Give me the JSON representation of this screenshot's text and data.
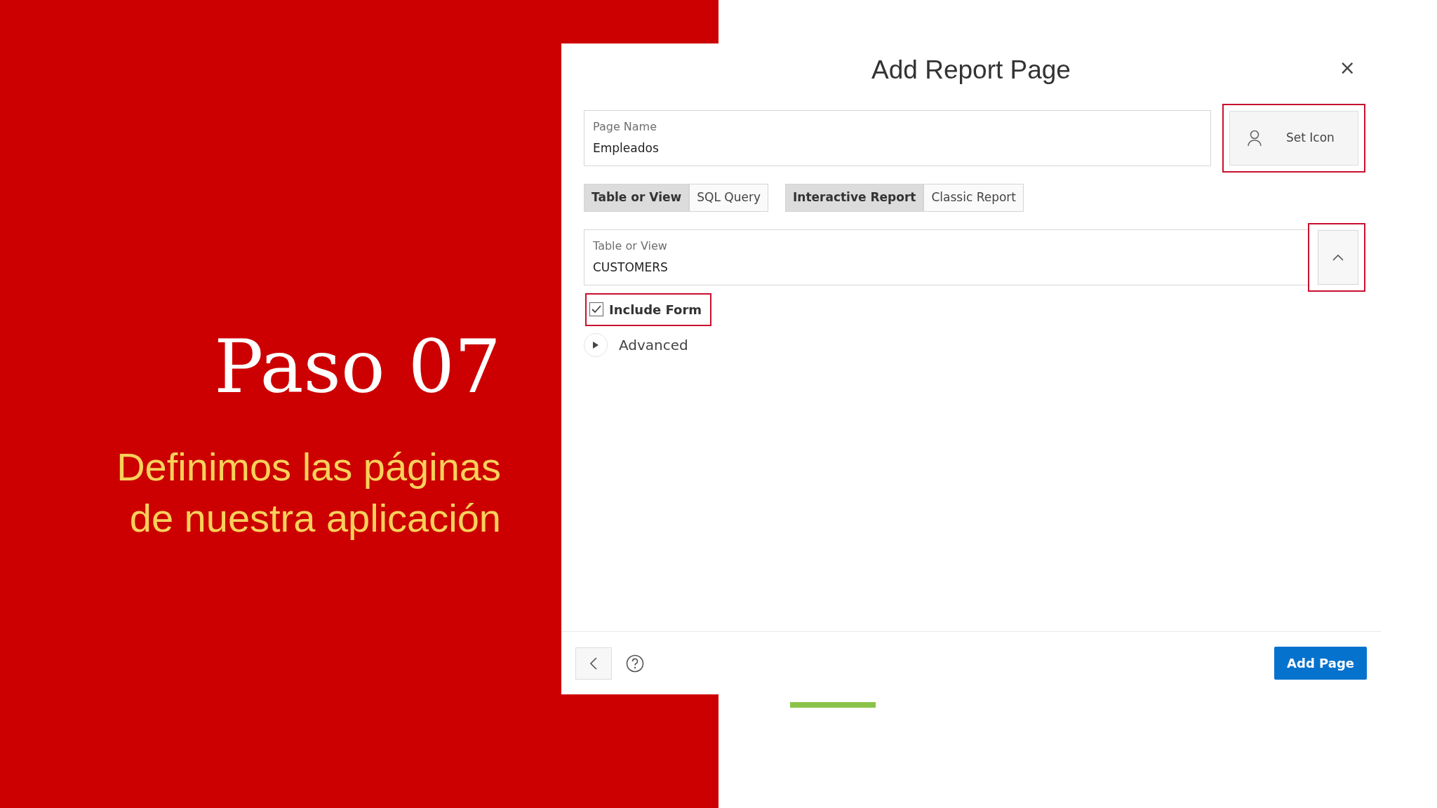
{
  "slide": {
    "title": "Paso 07",
    "subtitle": "Definimos las páginas de nuestra aplicación"
  },
  "dialog": {
    "title": "Add Report Page",
    "close": "×",
    "page_name": {
      "label": "Page Name",
      "value": "Empleados"
    },
    "set_icon": {
      "label": "Set Icon",
      "highlighted": true
    },
    "source_type": [
      {
        "label": "Table or View",
        "selected": true
      },
      {
        "label": "SQL Query",
        "selected": false
      }
    ],
    "report_type": [
      {
        "label": "Interactive Report",
        "selected": true
      },
      {
        "label": "Classic Report",
        "selected": false
      }
    ],
    "table_or_view": {
      "label": "Table or View",
      "value": "CUSTOMERS",
      "button_highlighted": true
    },
    "include_form": {
      "label": "Include Form",
      "checked": true,
      "highlighted": true
    },
    "advanced": {
      "label": "Advanced",
      "expanded": false
    },
    "footer": {
      "primary_button": "Add Page"
    }
  }
}
